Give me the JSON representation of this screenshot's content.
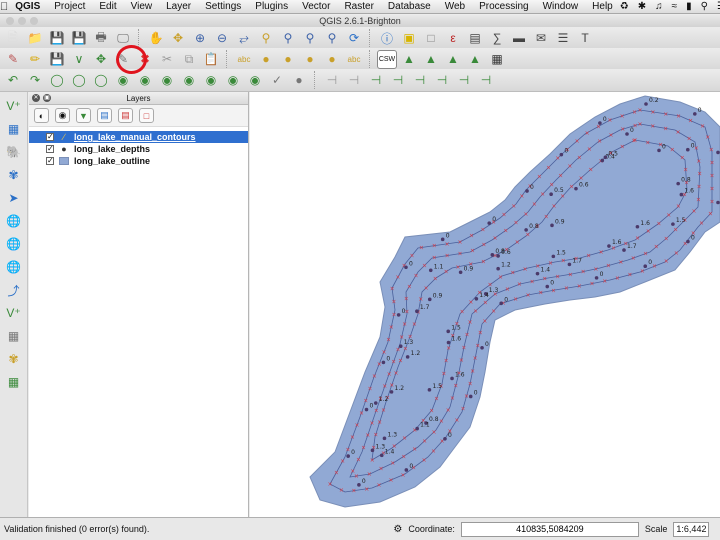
{
  "menubar": {
    "app_name": "QGIS",
    "menus": [
      "Project",
      "Edit",
      "View",
      "Layer",
      "Settings",
      "Plugins",
      "Vector",
      "Raster",
      "Database",
      "Web",
      "Processing",
      "Window",
      "Help"
    ]
  },
  "window": {
    "title": "QGIS 2.6.1-Brighton"
  },
  "toolbars": {
    "row1_icons": [
      "new-project-icon",
      "open-project-icon",
      "save-project-icon",
      "save-as-icon",
      "print-composer-icon",
      "composer-manager-icon",
      "pan-icon",
      "pan-to-selection-icon",
      "zoom-in-icon",
      "zoom-out-icon",
      "zoom-full-icon",
      "zoom-to-selection-icon",
      "zoom-to-layer-icon",
      "zoom-last-icon",
      "zoom-next-icon",
      "refresh-icon",
      "identify-icon",
      "select-icon",
      "deselect-icon",
      "field-calculator-icon",
      "attribute-table-icon",
      "statistics-icon",
      "measure-icon",
      "map-tips-icon",
      "bookmark-icon",
      "text-annotation-icon"
    ],
    "row2_icons": [
      "current-edits-icon",
      "toggle-editing-icon",
      "save-edits-icon",
      "add-feature-icon",
      "move-feature-icon",
      "node-tool-icon",
      "delete-selected-icon",
      "cut-features-icon",
      "copy-features-icon",
      "paste-features-icon",
      "label-tool-icon",
      "pin-labels-icon",
      "highlight-pinned-icon",
      "move-label-icon",
      "rotate-label-icon",
      "change-label-icon",
      "csw-icon",
      "gps-icon",
      "raster-icon",
      "plugin-icon",
      "georeferencer-icon",
      "grid-icon"
    ],
    "row3_icons": [
      "undo-icon",
      "redo-icon",
      "simplify-icon",
      "add-ring-icon",
      "add-part-icon",
      "fill-ring-icon",
      "delete-ring-icon",
      "delete-part-icon",
      "reshape-icon",
      "offset-curve-icon",
      "split-features-icon",
      "split-parts-icon",
      "merge-selected-icon",
      "merge-attributes-icon",
      "rotate-symbols-icon",
      "ruler-icon",
      "topology-icon",
      "digitize-icon",
      "snap-icon",
      "trace-icon",
      "vertex-icon",
      "advanced-digitize-icon"
    ]
  },
  "vertical_toolbar": {
    "icons": [
      "add-vector-layer-icon",
      "add-raster-layer-icon",
      "add-postgis-icon",
      "add-spatialite-icon",
      "add-mssql-icon",
      "add-wms-icon",
      "add-wcs-icon",
      "add-wfs-icon",
      "add-delimited-text-icon",
      "new-shapefile-icon",
      "add-oracle-icon",
      "new-spatialite-icon",
      "add-gpx-icon"
    ]
  },
  "layers_panel": {
    "title": "Layers",
    "layers": [
      {
        "name": "long_lake_manual_contours",
        "checked": true,
        "selected": true,
        "symbol": "line"
      },
      {
        "name": "long_lake_depths",
        "checked": true,
        "selected": false,
        "symbol": "point"
      },
      {
        "name": "long_lake_outline",
        "checked": true,
        "selected": false,
        "symbol": "polygon"
      }
    ]
  },
  "map": {
    "fill_color": "#91a9d4",
    "outline_color": "#7a8fb8",
    "contour_color": "#4a5f9a",
    "vertex_color": "#d9343f",
    "depth_labels": [
      "0",
      "0",
      "0",
      "0.8",
      "1.6",
      "1.5",
      "1.6",
      "1.7",
      "1.6",
      "1.7",
      "1.5",
      "1.4",
      "1.2",
      "1.3",
      "1.4",
      "1.5",
      "1.6",
      "1.6",
      "1.5",
      "0.8",
      "1.1",
      "1.4",
      "1.3",
      "1.3",
      "1.2",
      "1.2",
      "1.2",
      "1.3",
      "1.7",
      "0.9",
      "1.1",
      "0.9",
      "0.8",
      "0.6",
      "0.8",
      "0.9",
      "0.5",
      "0.6",
      "0.4",
      "0.5",
      "0.2",
      "0",
      "0",
      "0",
      "0",
      "0",
      "0",
      "0",
      "0",
      "0",
      "0",
      "0",
      "0",
      "0",
      "0",
      "0",
      "0",
      "0",
      "0",
      "0",
      "0",
      "0",
      "0",
      "0"
    ]
  },
  "statusbar": {
    "message": "Validation finished (0 error(s) found).",
    "coordinate_label": "Coordinate:",
    "coordinate_value": "410835,5084209",
    "scale_label": "Scale",
    "scale_value": "1:6,442"
  }
}
